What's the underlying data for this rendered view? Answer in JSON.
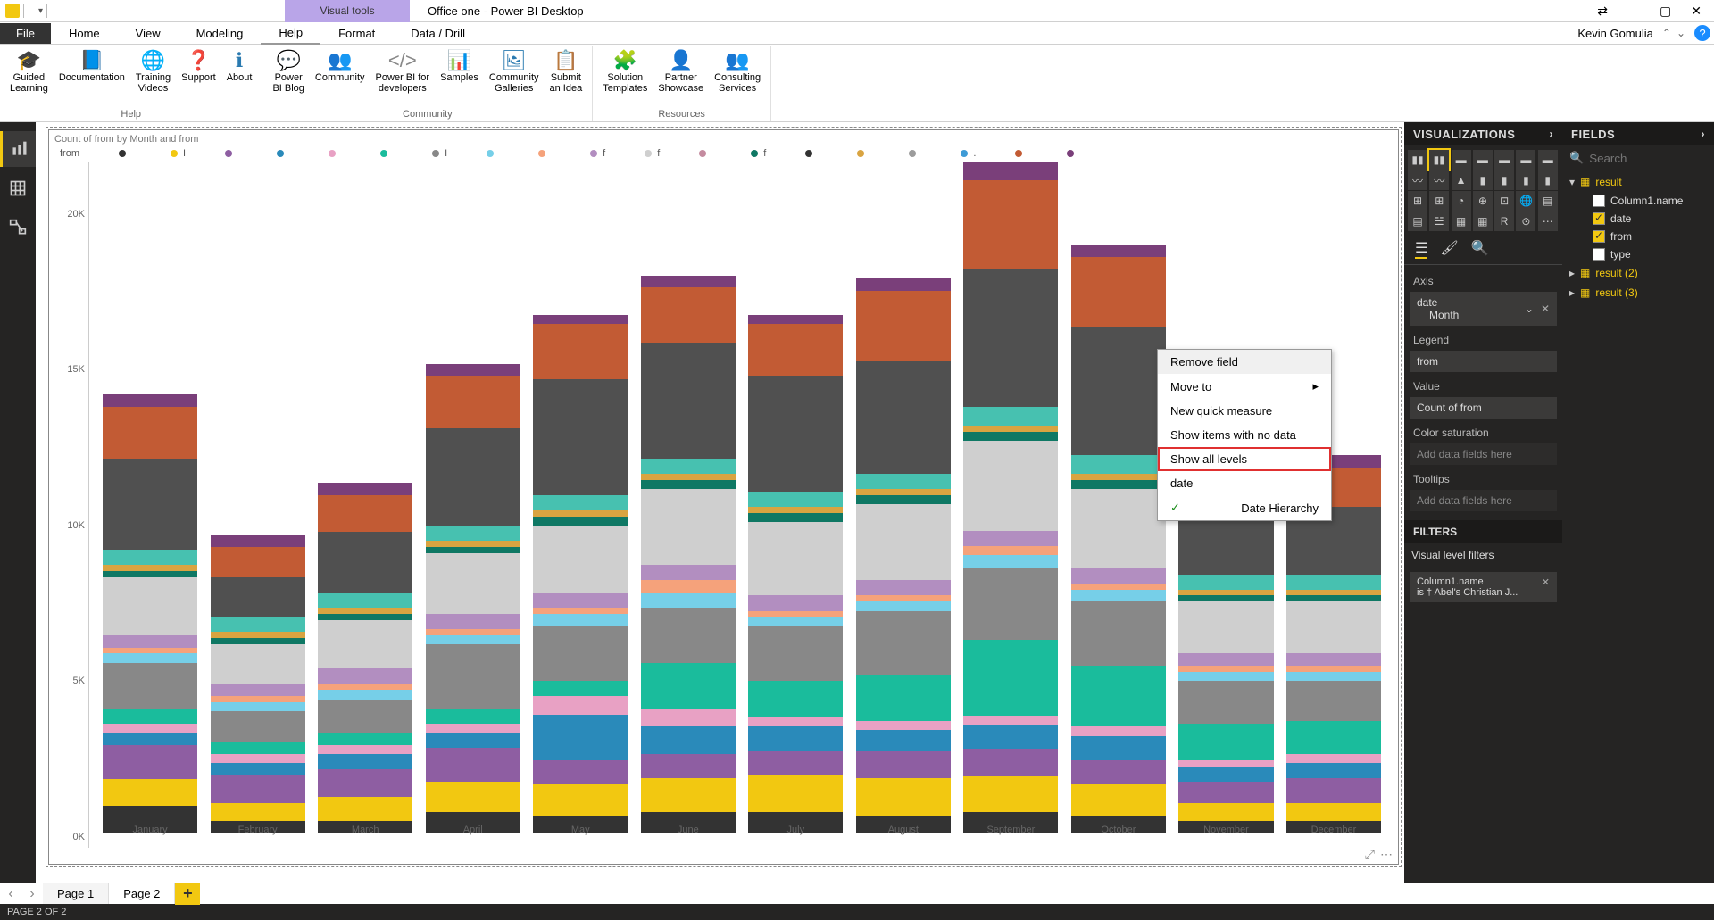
{
  "titlebar": {
    "visual_tools": "Visual tools",
    "title": "Office one - Power BI Desktop"
  },
  "menubar": {
    "file": "File",
    "tabs": [
      "Home",
      "View",
      "Modeling",
      "Help",
      "Format",
      "Data / Drill"
    ],
    "active_tab_index": 3,
    "user": "Kevin Gomulia"
  },
  "ribbon": {
    "groups": [
      {
        "name": "Help",
        "items": [
          {
            "label": "Guided\nLearning",
            "icon": "🎓",
            "color": "#2a7ab0"
          },
          {
            "label": "Documentation",
            "icon": "📘",
            "color": "#7c3fa0"
          },
          {
            "label": "Training\nVideos",
            "icon": "🌐",
            "color": "#2a7ab0"
          },
          {
            "label": "Support",
            "icon": "❓",
            "color": "#2a7ab0"
          },
          {
            "label": "About",
            "icon": "ℹ",
            "color": "#2a7ab0"
          }
        ]
      },
      {
        "name": "Community",
        "items": [
          {
            "label": "Power\nBI Blog",
            "icon": "💬",
            "color": "#2a7ab0"
          },
          {
            "label": "Community",
            "icon": "👥",
            "color": "#2a7ab0"
          },
          {
            "label": "Power BI for\ndevelopers",
            "icon": "</>",
            "color": "#888"
          },
          {
            "label": "Samples",
            "icon": "📊",
            "color": "#2a7ab0"
          },
          {
            "label": "Community\nGalleries",
            "icon": "🖼",
            "color": "#2a7ab0"
          },
          {
            "label": "Submit\nan Idea",
            "icon": "📋",
            "color": "#2a7ab0"
          }
        ]
      },
      {
        "name": "Resources",
        "items": [
          {
            "label": "Solution\nTemplates",
            "icon": "🧩",
            "color": "#2a7ab0"
          },
          {
            "label": "Partner\nShowcase",
            "icon": "👤",
            "color": "#2a7ab0"
          },
          {
            "label": "Consulting\nServices",
            "icon": "👥",
            "color": "#2a7ab0"
          }
        ]
      }
    ]
  },
  "chart": {
    "title": "Count of from by Month and from",
    "legend_label": "from"
  },
  "chart_data": {
    "type": "bar",
    "stacked": true,
    "title": "Count of from by Month and from",
    "xlabel": "",
    "ylabel": "",
    "ylim": [
      0,
      22000
    ],
    "yticks": [
      "0K",
      "5K",
      "10K",
      "15K",
      "20K"
    ],
    "categories": [
      "January",
      "February",
      "March",
      "April",
      "May",
      "June",
      "July",
      "August",
      "September",
      "October",
      "November",
      "December"
    ],
    "legend_items": [
      {
        "name": "",
        "color": "#333333"
      },
      {
        "name": "I",
        "color": "#f2c811"
      },
      {
        "name": "",
        "color": "#8e5ea2"
      },
      {
        "name": "",
        "color": "#2a8aba"
      },
      {
        "name": "",
        "color": "#e8a1c4"
      },
      {
        "name": "",
        "color": "#1abc9c"
      },
      {
        "name": "I",
        "color": "#888888"
      },
      {
        "name": "",
        "color": "#76cfe8"
      },
      {
        "name": "",
        "color": "#f5a27b"
      },
      {
        "name": "f",
        "color": "#b28ec0"
      },
      {
        "name": "f",
        "color": "#cfcfcf"
      },
      {
        "name": "",
        "color": "#c48b9f"
      },
      {
        "name": "f",
        "color": "#0f7864"
      },
      {
        "name": "",
        "color": "#333333"
      },
      {
        "name": "",
        "color": "#d9a441"
      },
      {
        "name": "",
        "color": "#9c9c9c"
      },
      {
        "name": ".",
        "color": "#3e9bd6"
      },
      {
        "name": "",
        "color": "#c25b34"
      },
      {
        "name": "",
        "color": "#7a3f7a"
      }
    ],
    "series_colors": [
      "#333333",
      "#f2c811",
      "#8e5ea2",
      "#2a8aba",
      "#e8a1c4",
      "#1abc9c",
      "#888888",
      "#76cfe8",
      "#f5a27b",
      "#b28ec0",
      "#cfcfcf",
      "#0f7864",
      "#d9a441",
      "#47c1b0",
      "#505050",
      "#c25b34",
      "#7a3f7a"
    ],
    "stacks": [
      {
        "total": 14400,
        "segments": [
          900,
          900,
          1100,
          400,
          300,
          500,
          1500,
          300,
          200,
          400,
          1900,
          200,
          200,
          500,
          3000,
          1700,
          400
        ]
      },
      {
        "total": 9800,
        "segments": [
          400,
          600,
          900,
          400,
          300,
          400,
          1000,
          300,
          200,
          400,
          1300,
          200,
          200,
          500,
          1300,
          1000,
          400
        ]
      },
      {
        "total": 11500,
        "segments": [
          400,
          800,
          900,
          500,
          300,
          400,
          1100,
          300,
          200,
          500,
          1600,
          200,
          200,
          500,
          2000,
          1200,
          400
        ]
      },
      {
        "total": 15400,
        "segments": [
          700,
          1000,
          1100,
          500,
          300,
          500,
          2100,
          300,
          200,
          500,
          2000,
          200,
          200,
          500,
          3200,
          1700,
          400
        ]
      },
      {
        "total": 17000,
        "segments": [
          600,
          1000,
          800,
          1500,
          600,
          500,
          1800,
          400,
          200,
          500,
          2200,
          300,
          200,
          500,
          3800,
          1800,
          300
        ]
      },
      {
        "total": 18300,
        "segments": [
          700,
          1100,
          800,
          900,
          600,
          1500,
          1800,
          500,
          400,
          500,
          2500,
          300,
          200,
          500,
          3800,
          1800,
          400
        ]
      },
      {
        "total": 17000,
        "segments": [
          700,
          1200,
          800,
          800,
          300,
          1200,
          1800,
          300,
          200,
          500,
          2400,
          300,
          200,
          500,
          3800,
          1700,
          300
        ]
      },
      {
        "total": 18200,
        "segments": [
          600,
          1200,
          900,
          700,
          300,
          1500,
          2100,
          300,
          200,
          500,
          2500,
          300,
          200,
          500,
          3700,
          2300,
          400
        ]
      },
      {
        "total": 22200,
        "segments": [
          700,
          1200,
          900,
          800,
          300,
          2500,
          2400,
          400,
          300,
          500,
          3000,
          300,
          200,
          600,
          4600,
          2900,
          600
        ]
      },
      {
        "total": 19300,
        "segments": [
          600,
          1000,
          800,
          800,
          300,
          2000,
          2100,
          400,
          200,
          500,
          2600,
          300,
          200,
          600,
          4200,
          2300,
          400
        ]
      },
      {
        "total": 12400,
        "segments": [
          400,
          600,
          700,
          500,
          200,
          1200,
          1400,
          300,
          200,
          400,
          1700,
          200,
          200,
          500,
          2200,
          1300,
          400
        ]
      },
      {
        "total": 12400,
        "segments": [
          400,
          600,
          800,
          500,
          300,
          1100,
          1300,
          300,
          200,
          400,
          1700,
          200,
          200,
          500,
          2200,
          1300,
          400
        ]
      }
    ]
  },
  "viz_pane": {
    "title": "VISUALIZATIONS",
    "wells": {
      "axis_label": "Axis",
      "axis_value": "date",
      "axis_sub": "Month",
      "legend_label": "Legend",
      "legend_value": "from",
      "value_label": "Value",
      "value_value": "Count of from",
      "colorsat_label": "Color saturation",
      "colorsat_ph": "Add data fields here",
      "tooltips_label": "Tooltips",
      "tooltips_ph": "Add data fields here"
    },
    "filters_title": "FILTERS",
    "filters_sub": "Visual level filters",
    "filter_item": "Column1.name\nis † Abel's Christian J..."
  },
  "fields_pane": {
    "title": "FIELDS",
    "search_ph": "Search",
    "tables": [
      {
        "name": "result",
        "fields": [
          {
            "name": "Column1.name",
            "checked": false
          },
          {
            "name": "date",
            "checked": true
          },
          {
            "name": "from",
            "checked": true
          },
          {
            "name": "type",
            "checked": false
          }
        ]
      },
      {
        "name": "result (2)",
        "fields": []
      },
      {
        "name": "result (3)",
        "fields": []
      }
    ]
  },
  "context_menu": {
    "items": [
      {
        "label": "Remove field",
        "hl": true
      },
      {
        "label": "Move to",
        "arrow": true
      },
      {
        "label": "New quick measure"
      },
      {
        "label": "Show items with no data"
      },
      {
        "label": "Show all levels",
        "boxed": true
      },
      {
        "label": "date"
      },
      {
        "label": "Date Hierarchy",
        "check": true
      }
    ]
  },
  "page_tabs": {
    "tabs": [
      "Page 1",
      "Page 2"
    ],
    "active_index": 1
  },
  "statusbar": {
    "text": "PAGE 2 OF 2"
  }
}
